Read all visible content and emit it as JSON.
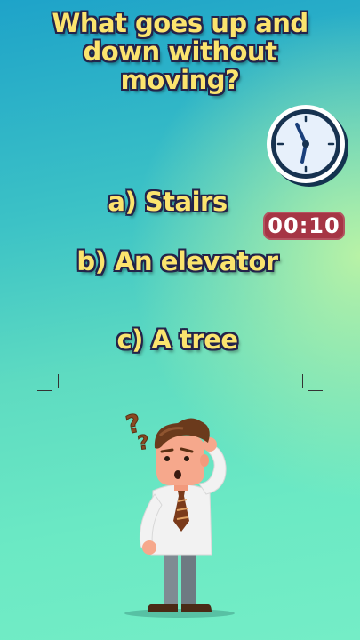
{
  "question": {
    "line1": "What goes up and",
    "line2": "down without",
    "line3": "moving?"
  },
  "options": {
    "a": "a) Stairs",
    "b": "b) An elevator",
    "c": "c) A tree"
  },
  "timer": {
    "text": "00:10"
  },
  "icons": {
    "clock": "clock-icon",
    "person": "confused-man-illustration",
    "question_marks": "question-marks-icon"
  },
  "colors": {
    "text_fill": "#fbe46e",
    "text_outline": "#23234a",
    "timer_bg": "#a63545"
  }
}
